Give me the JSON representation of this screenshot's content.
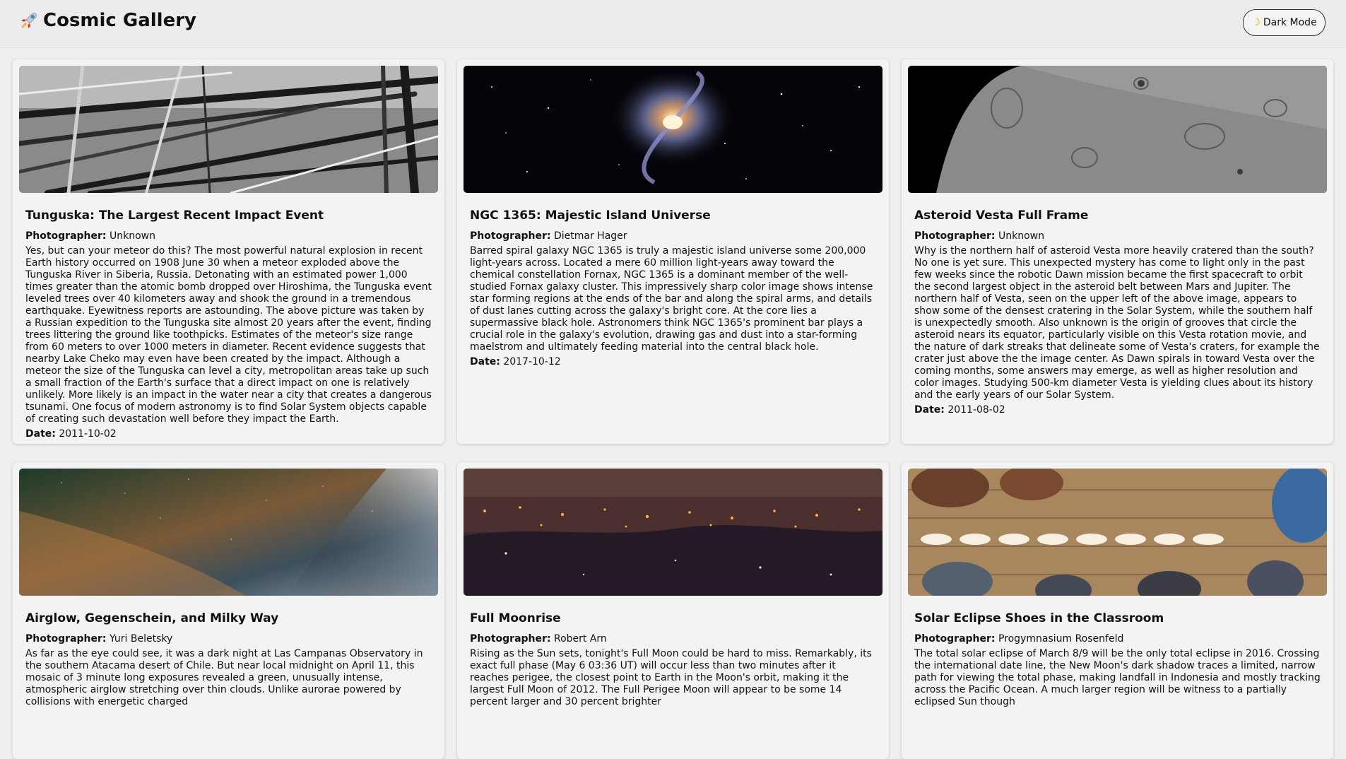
{
  "header": {
    "brand_icon": "rocket-icon",
    "title": "Cosmic Gallery",
    "mode_icon": "moon-icon",
    "mode_label": "Dark Mode"
  },
  "labels": {
    "photographer": "Photographer:",
    "date": "Date:"
  },
  "cards": [
    {
      "title": "Tunguska: The Largest Recent Impact Event",
      "photographer": "Unknown",
      "description": "Yes, but can your meteor do this? The most powerful natural explosion in recent Earth history occurred on 1908 June 30 when a meteor exploded above the Tunguska River in Siberia, Russia. Detonating with an estimated power 1,000 times greater than the atomic bomb dropped over Hiroshima, the Tunguska event leveled trees over 40 kilometers away and shook the ground in a tremendous earthquake. Eyewitness reports are astounding. The above picture was taken by a Russian expedition to the Tunguska site almost 20 years after the event, finding trees littering the ground like toothpicks. Estimates of the meteor's size range from 60 meters to over 1000 meters in diameter. Recent evidence suggests that nearby Lake Cheko may even have been created by the impact. Although a meteor the size of the Tunguska can level a city, metropolitan areas take up such a small fraction of the Earth's surface that a direct impact on one is relatively unlikely. More likely is an impact in the water near a city that creates a dangerous tsunami. One focus of modern astronomy is to find Solar System objects capable of creating such devastation well before they impact the Earth.",
      "date": "2011-10-02"
    },
    {
      "title": "NGC 1365: Majestic Island Universe",
      "photographer": "Dietmar Hager",
      "description": "Barred spiral galaxy NGC 1365 is truly a majestic island universe some 200,000 light-years across. Located a mere 60 million light-years away toward the chemical constellation Fornax, NGC 1365 is a dominant member of the well-studied Fornax galaxy cluster. This impressively sharp color image shows intense star forming regions at the ends of the bar and along the spiral arms, and details of dust lanes cutting across the galaxy's bright core. At the core lies a supermassive black hole. Astronomers think NGC 1365's prominent bar plays a crucial role in the galaxy's evolution, drawing gas and dust into a star-forming maelstrom and ultimately feeding material into the central black hole.",
      "date": "2017-10-12"
    },
    {
      "title": "Asteroid Vesta Full Frame",
      "photographer": "Unknown",
      "description": "Why is the northern half of asteroid Vesta more heavily cratered than the south? No one is yet sure. This unexpected mystery has come to light only in the past few weeks since the robotic Dawn mission became the first spacecraft to orbit the second largest object in the asteroid belt between Mars and Jupiter. The northern half of Vesta, seen on the upper left of the above image, appears to show some of the densest cratering in the Solar System, while the southern half is unexpectedly smooth. Also unknown is the origin of grooves that circle the asteroid nears its equator, particularly visible on this Vesta rotation movie, and the nature of dark streaks that delineate some of Vesta's craters, for example the crater just above the the image center. As Dawn spirals in toward Vesta over the coming months, some answers may emerge, as well as higher resolution and color images. Studying 500-km diameter Vesta is yielding clues about its history and the early years of our Solar System.",
      "date": "2011-08-02"
    },
    {
      "title": "Airglow, Gegenschein, and Milky Way",
      "photographer": "Yuri Beletsky",
      "description": "As far as the eye could see, it was a dark night at Las Campanas Observatory in the southern Atacama desert of Chile. But near local midnight on April 11, this mosaic of 3 minute long exposures revealed a green, unusually intense, atmospheric airglow stretching over thin clouds. Unlike aurorae powered by collisions with energetic charged",
      "date": ""
    },
    {
      "title": "Full Moonrise",
      "photographer": "Robert Arn",
      "description": "Rising as the Sun sets, tonight's Full Moon could be hard to miss. Remarkably, its exact full phase (May 6 03:36 UT) will occur less than two minutes after it reaches perigee, the closest point to Earth in the Moon's orbit, making it the largest Full Moon of 2012. The Full Perigee Moon will appear to be some 14 percent larger and 30 percent brighter",
      "date": ""
    },
    {
      "title": "Solar Eclipse Shoes in the Classroom",
      "photographer": "Progymnasium Rosenfeld",
      "description": "The total solar eclipse of March 8/9 will be the only total eclipse in 2016. Crossing the international date line, the New Moon's dark shadow traces a limited, narrow path for viewing the total phase, making landfall in Indonesia and mostly tracking across the Pacific Ocean. A much larger region will be witness to a partially eclipsed Sun though",
      "date": ""
    }
  ]
}
